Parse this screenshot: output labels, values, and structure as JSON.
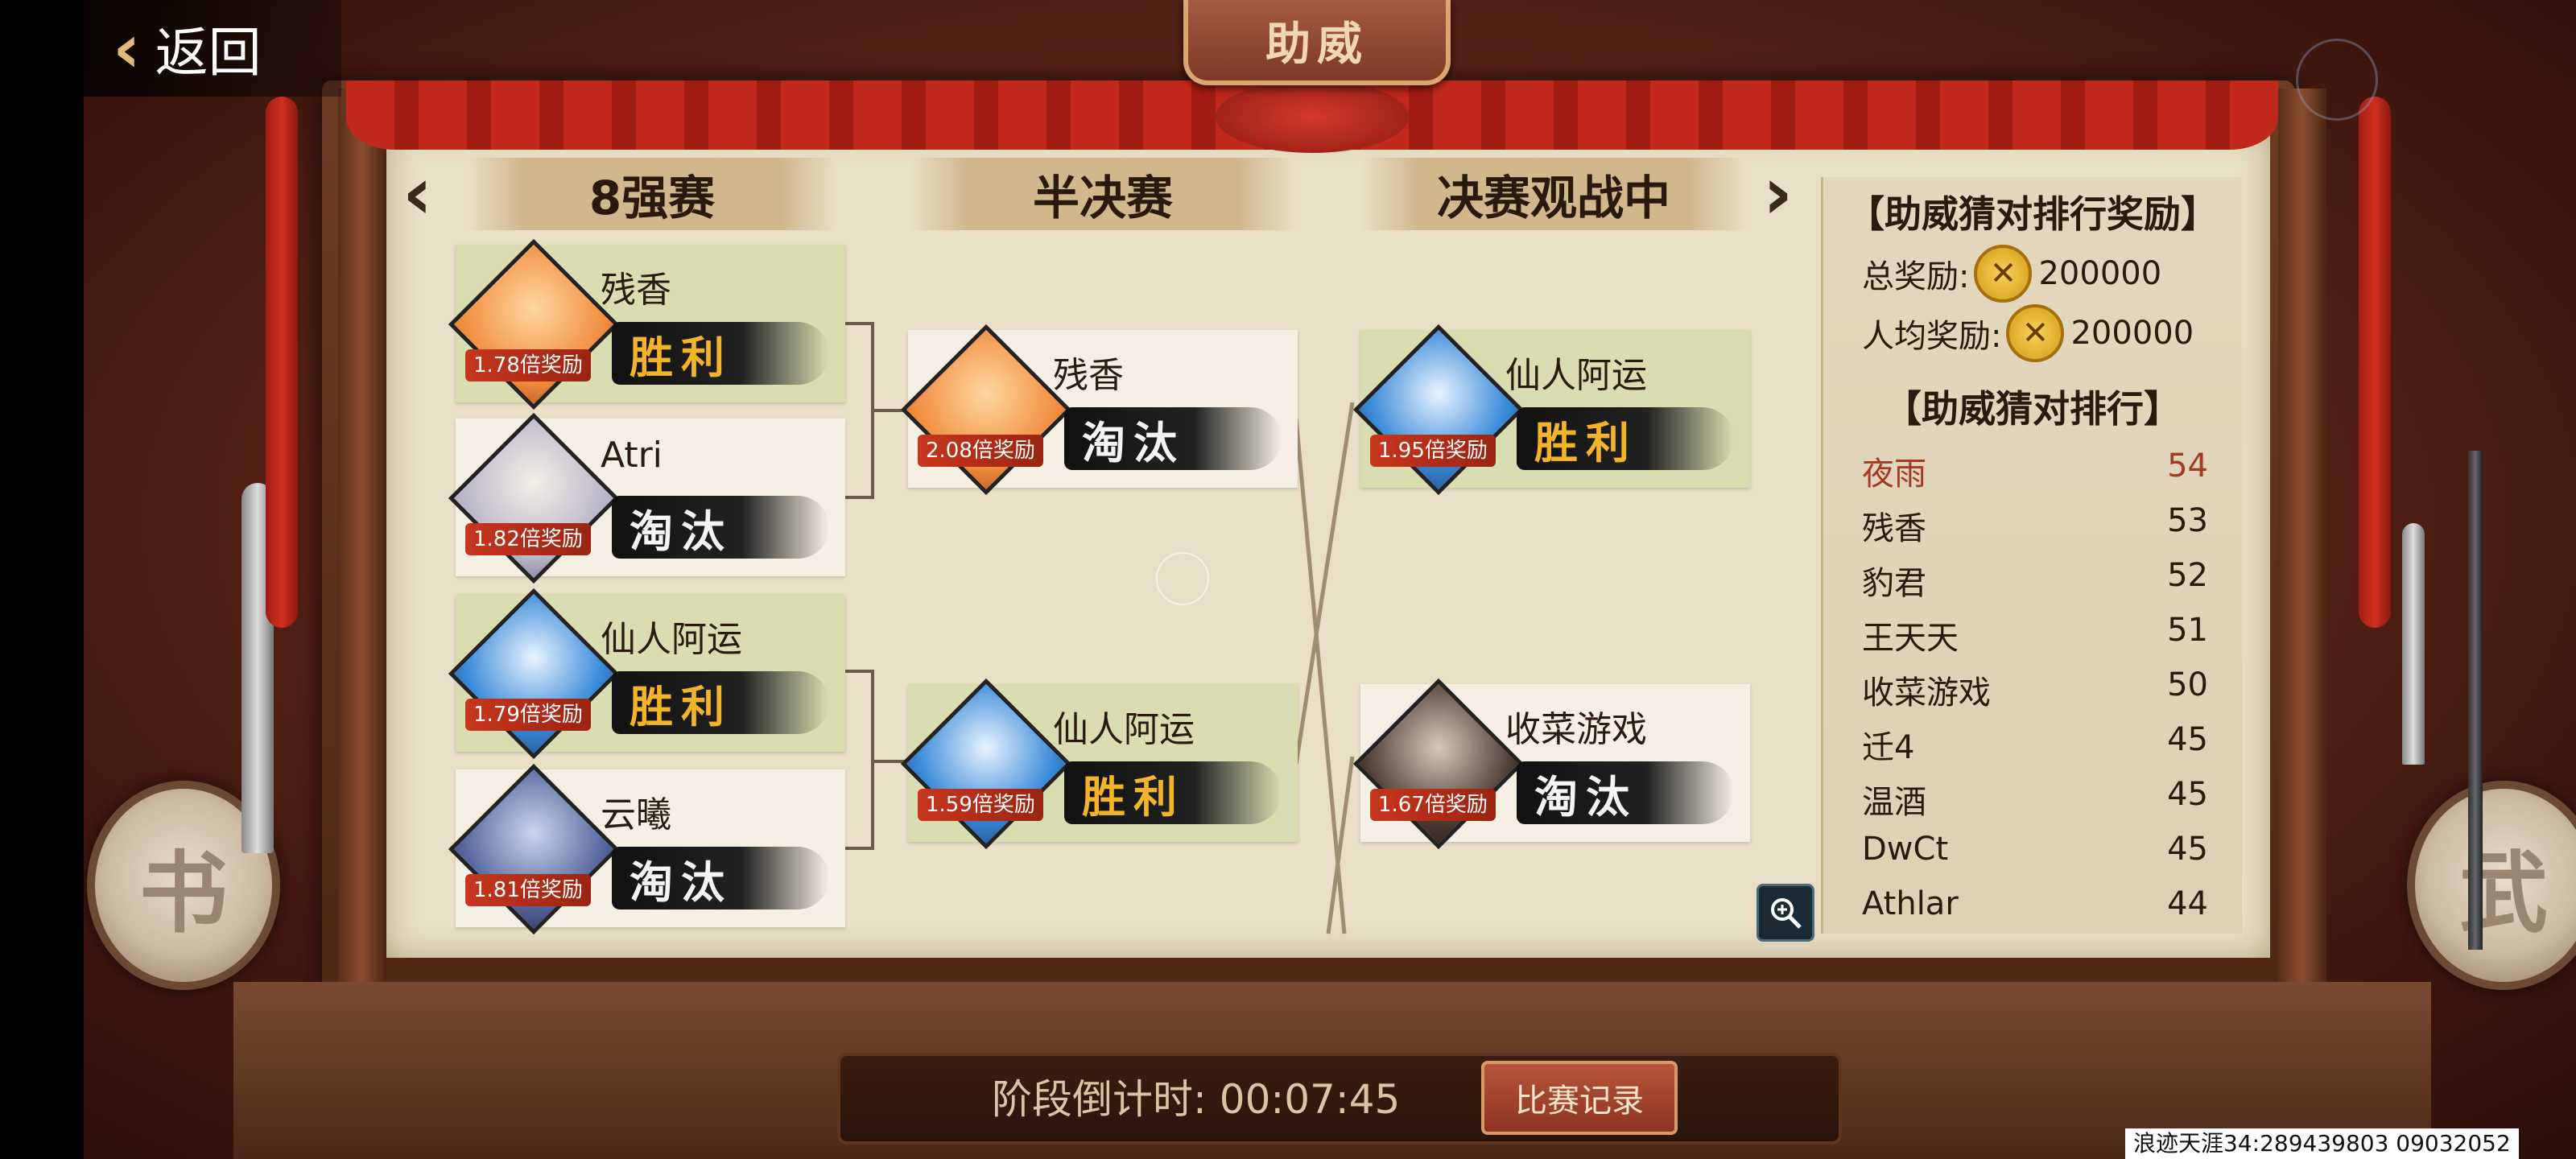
{
  "header": {
    "back_label": "返回",
    "title": "助威"
  },
  "stages": {
    "prev_arrow": "‹",
    "next_arrow": "›",
    "round1": "8强赛",
    "semi": "半决赛",
    "final": "决赛观战中"
  },
  "cards": {
    "r1": [
      {
        "name": "残香",
        "odds": "1.78倍奖励",
        "result": "胜利",
        "won": true
      },
      {
        "name": "Atri",
        "odds": "1.82倍奖励",
        "result": "淘汰",
        "won": false
      },
      {
        "name": "仙人阿运",
        "odds": "1.79倍奖励",
        "result": "胜利",
        "won": true
      },
      {
        "name": "云曦",
        "odds": "1.81倍奖励",
        "result": "淘汰",
        "won": false
      }
    ],
    "semi": [
      {
        "name": "残香",
        "odds": "2.08倍奖励",
        "result": "淘汰",
        "won": false
      },
      {
        "name": "仙人阿运",
        "odds": "1.59倍奖励",
        "result": "胜利",
        "won": true
      }
    ],
    "final": [
      {
        "name": "仙人阿运",
        "odds": "1.95倍奖励",
        "result": "胜利",
        "won": true
      },
      {
        "name": "收菜游戏",
        "odds": "1.67倍奖励",
        "result": "淘汰",
        "won": false
      }
    ]
  },
  "reward_panel": {
    "title": "【助威猜对排行奖励】",
    "total_label": "总奖励:",
    "total_value": "200000",
    "per_person_label": "人均奖励:",
    "per_person_value": "200000",
    "ranking_title": "【助威猜对排行】",
    "ranking": [
      {
        "name": "夜雨",
        "score": "54"
      },
      {
        "name": "残香",
        "score": "53"
      },
      {
        "name": "豹君",
        "score": "52"
      },
      {
        "name": "王天天",
        "score": "51"
      },
      {
        "name": "收菜游戏",
        "score": "50"
      },
      {
        "name": "迁4",
        "score": "45"
      },
      {
        "name": "温酒",
        "score": "45"
      },
      {
        "name": "DwCt",
        "score": "45"
      },
      {
        "name": "Athlar",
        "score": "44"
      }
    ]
  },
  "footer": {
    "timer_label": "阶段倒计时:",
    "timer_value": "00:07:45",
    "record_button": "比赛记录",
    "player_id": "浪迹天涯34:289439803 09032052"
  },
  "colors": {
    "win_card": "#d9ddb0",
    "lose_card": "#f6efe3",
    "win_text": "#f3b42a",
    "top_rank": "#a33a24"
  },
  "icons": {
    "back": "chevron-left-icon",
    "coin": "coin-icon",
    "zoom": "zoom-in-icon"
  }
}
